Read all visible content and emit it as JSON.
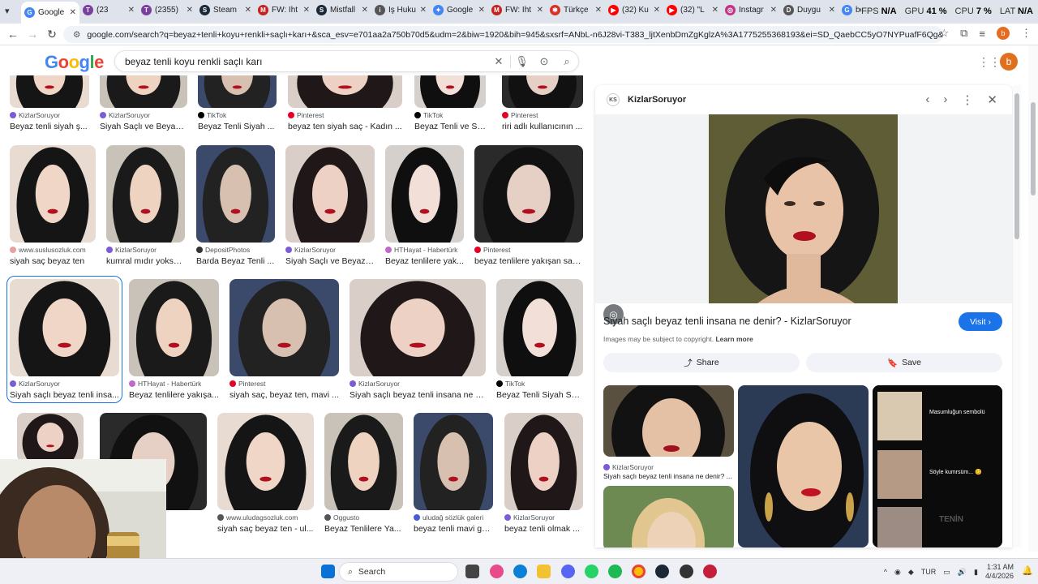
{
  "tabs": [
    {
      "title": "Google",
      "color": "#4285f4",
      "glyph": "G"
    },
    {
      "title": "(23",
      "color": "#7b3fa0",
      "glyph": "T"
    },
    {
      "title": "(2355)",
      "color": "#7b3fa0",
      "glyph": "T"
    },
    {
      "title": "Steam",
      "color": "#1b2838",
      "glyph": "S"
    },
    {
      "title": "FW: İht",
      "color": "#c5221f",
      "glyph": "M"
    },
    {
      "title": "Mistfall",
      "color": "#1b2838",
      "glyph": "S"
    },
    {
      "title": "İş Huku",
      "color": "#555555",
      "glyph": "i"
    },
    {
      "title": "Google",
      "color": "#4285f4",
      "glyph": "✦"
    },
    {
      "title": "FW: İht",
      "color": "#c5221f",
      "glyph": "M"
    },
    {
      "title": "Türkçe",
      "color": "#d93025",
      "glyph": "✱"
    },
    {
      "title": "(32) Ku",
      "color": "#ff0000",
      "glyph": "▶"
    },
    {
      "title": "(32) \"L",
      "color": "#ff0000",
      "glyph": "▶"
    },
    {
      "title": "Instagr",
      "color": "#c13584",
      "glyph": "◎"
    },
    {
      "title": "Duygu",
      "color": "#555555",
      "glyph": "D"
    },
    {
      "title": "beyaz",
      "color": "#4285f4",
      "glyph": "G"
    }
  ],
  "overlay": {
    "fps_label": "FPS",
    "fps_value": "N/A",
    "gpu_label": "GPU",
    "gpu_value": "41 %",
    "cpu_label": "CPU",
    "cpu_value": "7 %",
    "lat_label": "LAT",
    "lat_value": "N/A"
  },
  "address": {
    "url": "google.com/search?q=beyaz+tenli+koyu+renkli+saçlı+karı+&sca_esv=e701aa2a750b70d5&udm=2&biw=1920&bih=945&sxsrf=ANbL-n6J28vi-T383_ljtXenbDmZgKglzA%3A1775255368193&ei=SD_QaebCC5yO7NYPuafF6Qg&ved=0ahUKEwjmhu3..."
  },
  "search": {
    "query": "beyaz tenli koyu renkli saçlı karı",
    "logo": "Google"
  },
  "profile_letter": "b",
  "results_row0": [
    {
      "source": "KizlarSoruyor",
      "caption": "Beyaz tenli siyah ş...",
      "color": "#7b5bd6"
    },
    {
      "source": "KizlarSoruyor",
      "caption": "Siyah Saçlı ve Beyaz ...",
      "color": "#7b5bd6"
    },
    {
      "source": "TikTok",
      "caption": "Beyaz Tenli Siyah ...",
      "color": "#000000"
    },
    {
      "source": "Pinterest",
      "caption": "beyaz ten siyah saç - Kadın ...",
      "color": "#e60023"
    },
    {
      "source": "TikTok",
      "caption": "Beyaz Tenli ve Siy...",
      "color": "#000000"
    },
    {
      "source": "Pinterest",
      "caption": "riri adlı kullanıcının ...",
      "color": "#e60023"
    }
  ],
  "results_row1": [
    {
      "source": "www.suslusozluk.com",
      "caption": "siyah saç beyaz ten",
      "color": "#e8a0a0"
    },
    {
      "source": "KizlarSoruyor",
      "caption": "kumral mıdır yoksa...",
      "color": "#7b5bd6"
    },
    {
      "source": "DepositPhotos",
      "caption": "Barda Beyaz Tenli ...",
      "color": "#333333"
    },
    {
      "source": "KizlarSoruyor",
      "caption": "Siyah Saçlı ve Beyaz ...",
      "color": "#7b5bd6"
    },
    {
      "source": "HTHayat - Habertürk",
      "caption": "Beyaz tenlilere yak...",
      "color": "#c069c9"
    },
    {
      "source": "Pinterest",
      "caption": "beyaz tenlilere yakışan saç ...",
      "color": "#e60023"
    }
  ],
  "results_row2": [
    {
      "source": "KizlarSoruyor",
      "caption": "Siyah saçlı beyaz tenli insa...",
      "color": "#7b5bd6"
    },
    {
      "source": "HTHayat - Habertürk",
      "caption": "Beyaz tenlilere yakışa...",
      "color": "#c069c9"
    },
    {
      "source": "Pinterest",
      "caption": "siyah saç, beyaz ten, mavi ...",
      "color": "#e60023"
    },
    {
      "source": "KizlarSoruyor",
      "caption": "Siyah saçlı beyaz tenli insana ne de...",
      "color": "#7b5bd6"
    },
    {
      "source": "TikTok",
      "caption": "Beyaz Tenli Siyah Sa...",
      "color": "#000000"
    }
  ],
  "results_row3": [
    {
      "source": "k",
      "caption": "an Saç R...",
      "color": "#ffffff"
    },
    {
      "source": "www.uludagsozluk.com",
      "caption": "siyah saç beyaz ten - ul...",
      "color": "#555555"
    },
    {
      "source": "Oggusto",
      "caption": "Beyaz Tenlilere Ya...",
      "color": "#555555"
    },
    {
      "source": "uludağ sözlük galeri",
      "caption": "beyaz tenli mavi gö...",
      "color": "#4a5bd6"
    },
    {
      "source": "KizlarSoruyor",
      "caption": "beyaz tenli olmak ...",
      "color": "#7b5bd6"
    }
  ],
  "panel": {
    "source": "KizlarSoruyor",
    "title": "Siyah saçlı beyaz tenli insana ne denir? - KizlarSoruyor",
    "visit": "Visit",
    "copyright": "Images may be subject to copyright.",
    "learn_more": "Learn more",
    "share": "Share",
    "save": "Save",
    "related_source": "KizlarSoruyor",
    "related_caption": "Siyah saçlı beyaz tenli insana ne denir? ...",
    "related_text1": "Masumluğun sembolü",
    "related_text2": "Söyle kumrsüm... 😊",
    "related_text3": "TENİN"
  },
  "taskbar": {
    "search": "Search",
    "lang": "TUR",
    "time": "1:31 AM",
    "date": "4/4/2026"
  }
}
